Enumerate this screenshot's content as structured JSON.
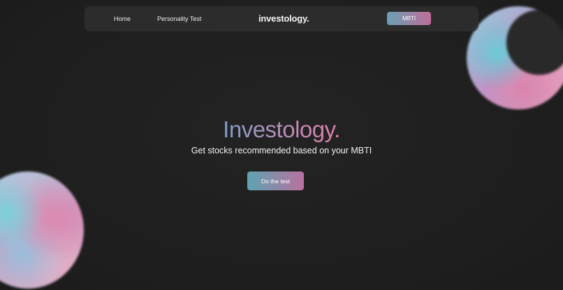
{
  "nav": {
    "links": [
      {
        "label": "Home"
      },
      {
        "label": "Personality Test"
      }
    ],
    "brand": "investology.",
    "cta_label": "MBTI"
  },
  "hero": {
    "title": "Investology.",
    "subtitle": "Get stocks recommended based on your MBTI",
    "cta_label": "Do the test"
  },
  "colors": {
    "background": "#1f1f1f",
    "navbar": "#323232",
    "gradient_start": "#5ea3b3",
    "gradient_end": "#c06d9a",
    "text": "#f4f4f4"
  }
}
